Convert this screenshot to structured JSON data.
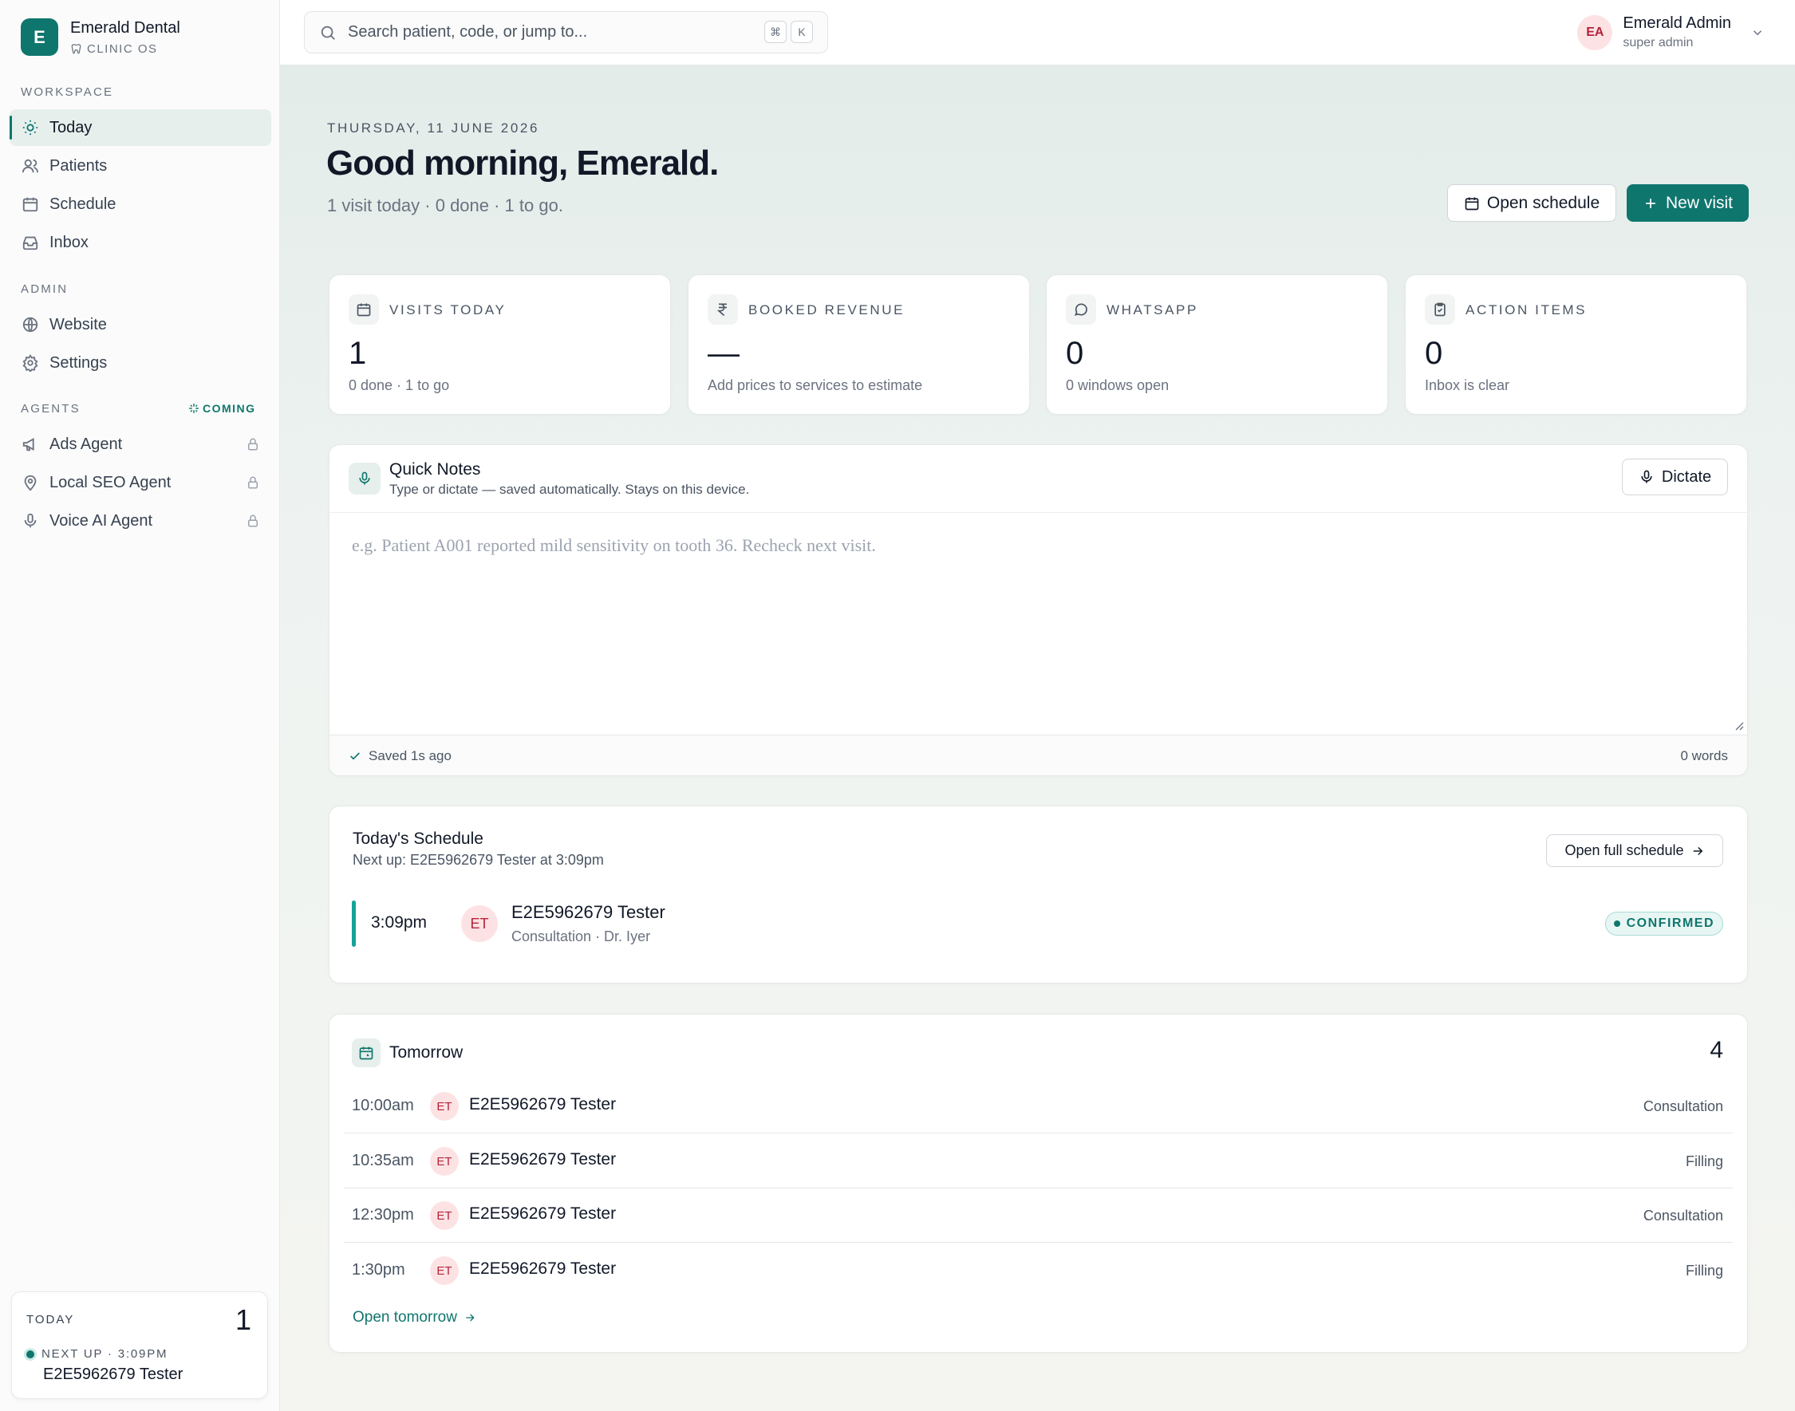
{
  "brand": {
    "name": "Emerald Dental",
    "logo_letter": "E",
    "subtitle": "CLINIC OS"
  },
  "sidebar": {
    "workspace_label": "WORKSPACE",
    "workspace_items": [
      {
        "label": "Today",
        "icon": "sun-icon",
        "active": true
      },
      {
        "label": "Patients",
        "icon": "users-icon"
      },
      {
        "label": "Schedule",
        "icon": "calendar-icon"
      },
      {
        "label": "Inbox",
        "icon": "inbox-icon"
      }
    ],
    "admin_label": "ADMIN",
    "admin_items": [
      {
        "label": "Website",
        "icon": "globe-icon"
      },
      {
        "label": "Settings",
        "icon": "gear-icon"
      }
    ],
    "agents_label": "AGENTS",
    "agents_badge": "COMING",
    "agent_items": [
      {
        "label": "Ads Agent",
        "icon": "megaphone-icon",
        "locked": true
      },
      {
        "label": "Local SEO Agent",
        "icon": "map-pin-icon",
        "locked": true
      },
      {
        "label": "Voice AI Agent",
        "icon": "mic-icon",
        "locked": true
      }
    ],
    "today_card": {
      "label": "TODAY",
      "count": "1",
      "next_label": "NEXT UP · 3:09PM",
      "next_name": "E2E5962679 Tester"
    }
  },
  "topbar": {
    "search_placeholder": "Search patient, code, or jump to...",
    "kbd_1": "⌘",
    "kbd_2": "K",
    "user": {
      "initials": "EA",
      "name": "Emerald Admin",
      "role": "super admin"
    }
  },
  "header": {
    "date": "THURSDAY, 11 JUNE 2026",
    "greeting": "Good morning, Emerald.",
    "summary": "1 visit today · 0 done · 1 to go.",
    "open_schedule_label": "Open schedule",
    "new_visit_label": "New visit"
  },
  "stats": [
    {
      "label": "VISITS TODAY",
      "value": "1",
      "sub": "0 done · 1 to go",
      "icon": "calendar-icon"
    },
    {
      "label": "BOOKED REVENUE",
      "value": "—",
      "sub": "Add prices to services to estimate",
      "icon": "rupee-icon"
    },
    {
      "label": "WHATSAPP",
      "value": "0",
      "sub": "0 windows open",
      "icon": "chat-bubble-icon"
    },
    {
      "label": "ACTION ITEMS",
      "value": "0",
      "sub": "Inbox is clear",
      "icon": "clipboard-check-icon"
    }
  ],
  "notes": {
    "title": "Quick Notes",
    "subtitle": "Type or dictate — saved automatically. Stays on this device.",
    "dictate_label": "Dictate",
    "placeholder": "e.g. Patient A001 reported mild sensitivity on tooth 36. Recheck next visit.",
    "saved_text": "Saved 1s ago",
    "word_count": "0 words"
  },
  "schedule": {
    "title": "Today's Schedule",
    "next_up": "Next up: E2E5962679 Tester at 3:09pm",
    "open_full_label": "Open full schedule",
    "appointment": {
      "time": "3:09pm",
      "initials": "ET",
      "name": "E2E5962679 Tester",
      "meta": "Consultation · Dr. Iyer",
      "status": "CONFIRMED"
    }
  },
  "tomorrow": {
    "title": "Tomorrow",
    "count": "4",
    "rows": [
      {
        "time": "10:00am",
        "initials": "ET",
        "name": "E2E5962679 Tester",
        "type": "Consultation"
      },
      {
        "time": "10:35am",
        "initials": "ET",
        "name": "E2E5962679 Tester",
        "type": "Filling"
      },
      {
        "time": "12:30pm",
        "initials": "ET",
        "name": "E2E5962679 Tester",
        "type": "Consultation"
      },
      {
        "time": "1:30pm",
        "initials": "ET",
        "name": "E2E5962679 Tester",
        "type": "Filling"
      }
    ],
    "open_label": "Open tomorrow"
  },
  "colors": {
    "accent": "#0f766e",
    "avatar_bg": "#fde2e4",
    "avatar_text": "#b4233a"
  }
}
